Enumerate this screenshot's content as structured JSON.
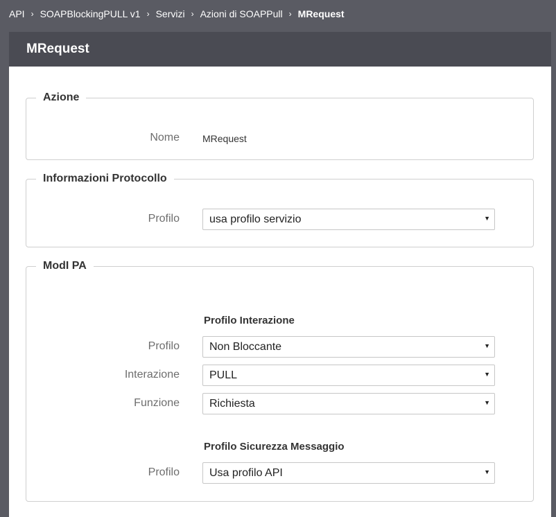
{
  "breadcrumb": {
    "items": [
      "API",
      "SOAPBlockingPULL v1",
      "Servizi",
      "Azioni di SOAPPull"
    ],
    "current": "MRequest",
    "separator": "›"
  },
  "page": {
    "title": "MRequest"
  },
  "azione": {
    "legend": "Azione",
    "nome_label": "Nome",
    "nome_value": "MRequest"
  },
  "protocollo": {
    "legend": "Informazioni Protocollo",
    "profilo_label": "Profilo",
    "profilo_value": "usa profilo servizio"
  },
  "modipa": {
    "legend": "ModI PA",
    "interazione_title": "Profilo Interazione",
    "profilo_label": "Profilo",
    "profilo_value": "Non Bloccante",
    "interazione_label": "Interazione",
    "interazione_value": "PULL",
    "funzione_label": "Funzione",
    "funzione_value": "Richiesta",
    "sicurezza_title": "Profilo Sicurezza Messaggio",
    "sicurezza_profilo_label": "Profilo",
    "sicurezza_profilo_value": "Usa profilo API"
  },
  "icons": {
    "dropdown": "caret-down-icon",
    "separator": "chevron-right-icon"
  },
  "colors": {
    "background": "#5a5b63",
    "header": "#4a4b53",
    "panel": "#ffffff"
  }
}
